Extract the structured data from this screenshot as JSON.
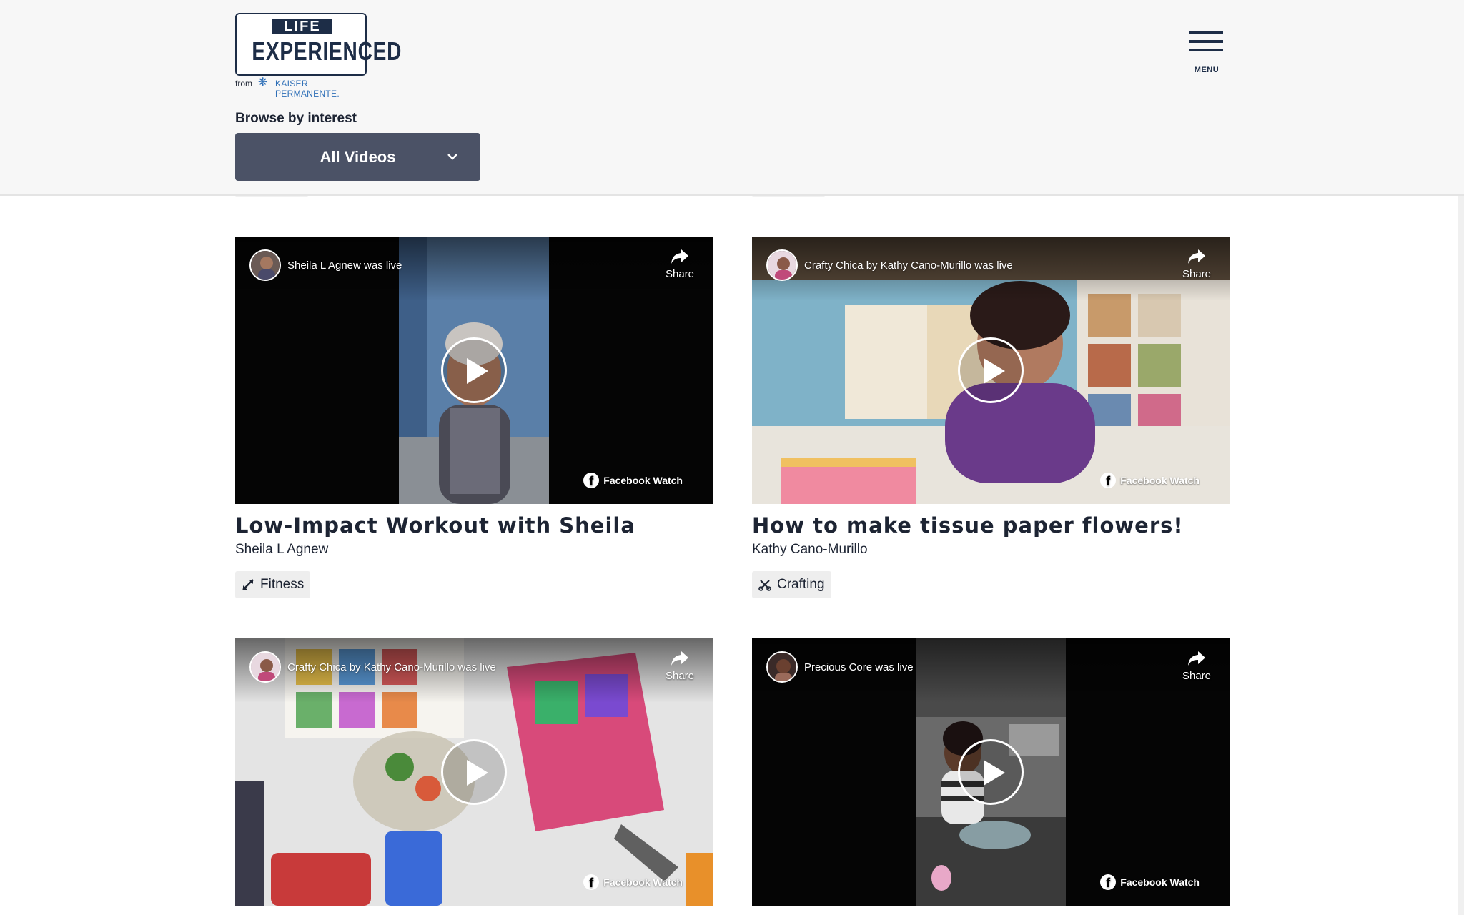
{
  "brand": {
    "life": "LIFE",
    "experienced": "EXPERIENCED",
    "from": "from",
    "kaiser": "KAISER PERMANENTE."
  },
  "menu": {
    "label": "MENU"
  },
  "filter": {
    "label": "Browse by interest",
    "selected": "All Videos"
  },
  "videos": [
    {
      "live_text": "Sheila L Agnew was live",
      "share": "Share",
      "fb_watch": "Facebook Watch",
      "title": "Low-Impact Workout with Sheila",
      "author": "Sheila L Agnew",
      "tag": "Fitness",
      "tag_icon": "expand-arrows-icon"
    },
    {
      "live_text": "Crafty Chica by Kathy Cano-Murillo was live",
      "share": "Share",
      "fb_watch": "Facebook Watch",
      "title": "How to make tissue paper flowers!",
      "author": "Kathy Cano-Murillo",
      "tag": "Crafting",
      "tag_icon": "scissors-icon"
    },
    {
      "live_text": "Crafty Chica by Kathy Cano-Murillo was live",
      "share": "Share",
      "fb_watch": "Facebook Watch"
    },
    {
      "live_text": "Precious Core was live",
      "share": "Share",
      "fb_watch": "Facebook Watch"
    }
  ],
  "colors": {
    "header_bg": "#f7f7f7",
    "dropdown_bg": "#4b5266",
    "brand_navy": "#1d2d47",
    "kaiser_blue": "#2e6fb7",
    "tag_bg": "#eeeeee"
  }
}
